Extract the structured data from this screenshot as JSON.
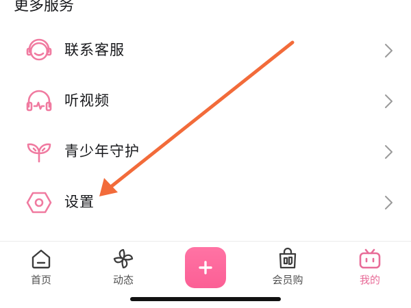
{
  "section": {
    "title": "更多服务"
  },
  "menu": {
    "items": [
      {
        "label": "联系客服",
        "icon": "headset-icon"
      },
      {
        "label": "听视频",
        "icon": "headphones-icon"
      },
      {
        "label": "青少年守护",
        "icon": "sprout-icon"
      },
      {
        "label": "设置",
        "icon": "settings-icon"
      }
    ]
  },
  "tabbar": {
    "tabs": [
      {
        "label": "首页",
        "icon": "home-icon"
      },
      {
        "label": "动态",
        "icon": "pinwheel-icon"
      },
      {
        "label": "",
        "icon": "plus-icon"
      },
      {
        "label": "会员购",
        "icon": "shopping-bag-icon"
      },
      {
        "label": "我的",
        "icon": "tv-icon",
        "active": true
      }
    ]
  },
  "colors": {
    "accent": "#fb7299",
    "arrow": "#f26b3a",
    "text": "#18191c"
  }
}
